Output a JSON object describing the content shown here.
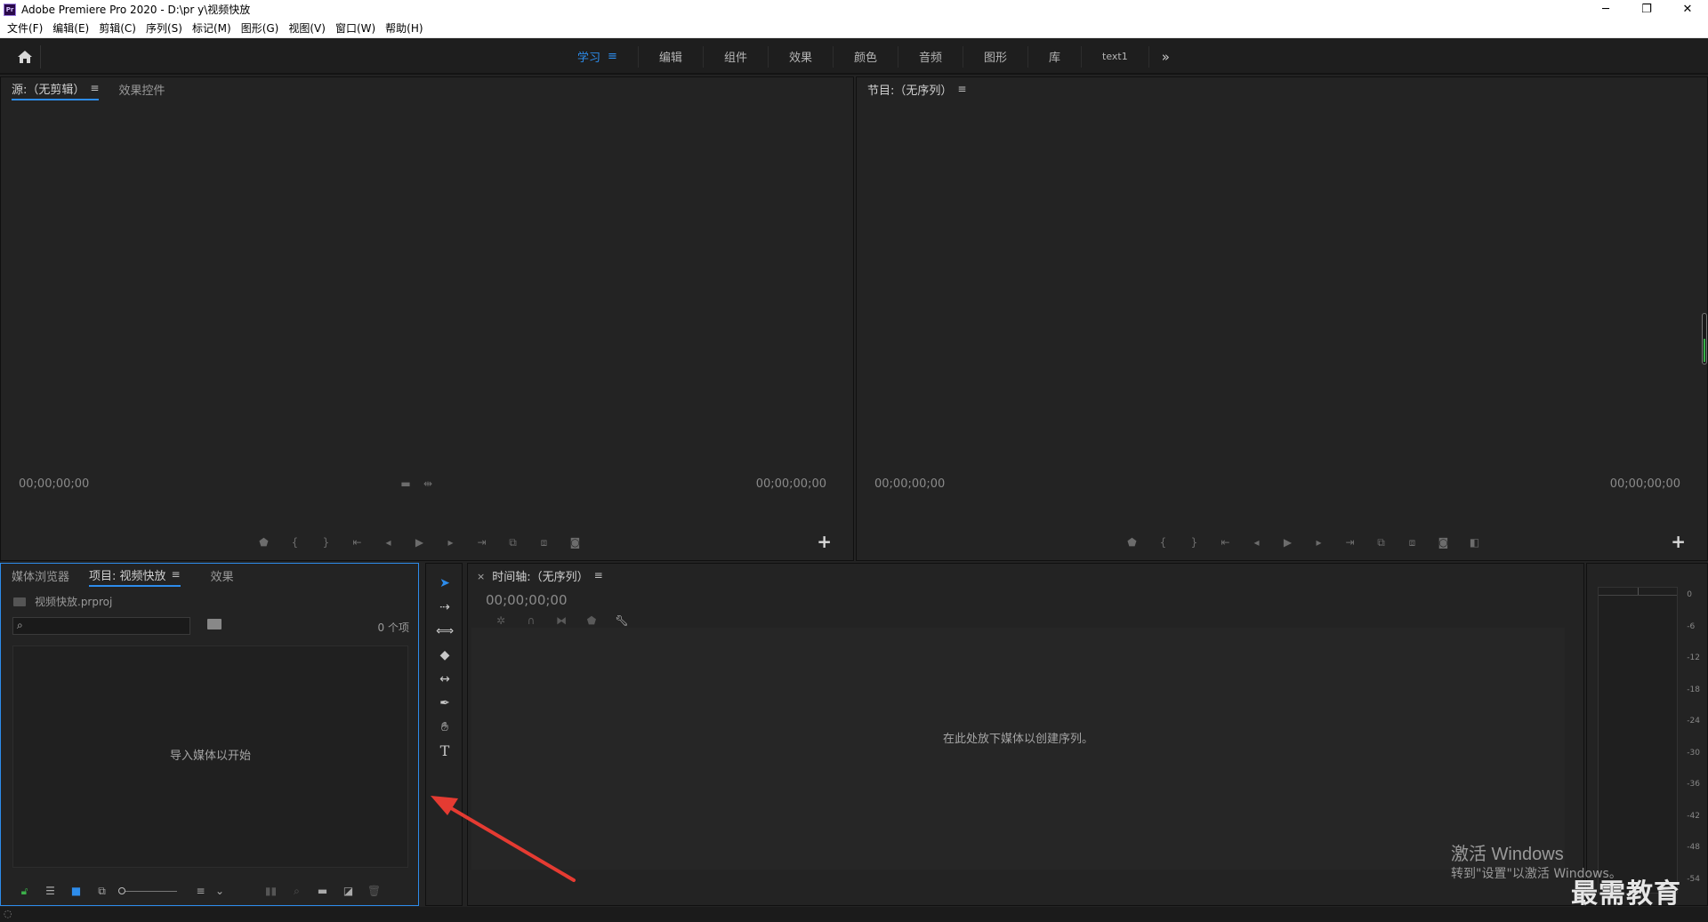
{
  "window": {
    "title": "Adobe Premiere Pro 2020 - D:\\pr y\\视频快放",
    "app_badge": "Pr",
    "minimize": "─",
    "restore": "❐",
    "close": "✕"
  },
  "menubar": {
    "items": [
      "文件(F)",
      "编辑(E)",
      "剪辑(C)",
      "序列(S)",
      "标记(M)",
      "图形(G)",
      "视图(V)",
      "窗口(W)",
      "帮助(H)"
    ]
  },
  "workspaces": {
    "tabs": [
      "学习",
      "编辑",
      "组件",
      "效果",
      "颜色",
      "音频",
      "图形",
      "库",
      "text1"
    ],
    "active": "学习",
    "more": "»"
  },
  "source_panel": {
    "tabs": [
      "源:（无剪辑）",
      "效果控件"
    ],
    "timecode_left": "00;00;00;00",
    "timecode_right": "00;00;00;00"
  },
  "program_panel": {
    "tab": "节目:（无序列）",
    "timecode_left": "00;00;00;00",
    "timecode_right": "00;00;00;00"
  },
  "project_panel": {
    "tabs": [
      "媒体浏览器",
      "项目: 视频快放",
      "效果"
    ],
    "project_file": "视频快放.prproj",
    "item_count": "0 个项",
    "empty_message": "导入媒体以开始"
  },
  "timeline_panel": {
    "tab": "时间轴:（无序列）",
    "timecode": "00;00;00;00",
    "empty_message": "在此处放下媒体以创建序列。"
  },
  "audio_meter": {
    "scale": [
      "0",
      "-6",
      "-12",
      "-18",
      "-24",
      "-30",
      "-36",
      "-42",
      "-48",
      "-54"
    ]
  },
  "watermark": {
    "line1": "激活 Windows",
    "line2": "转到\"设置\"以激活 Windows。",
    "brand": "最需教育"
  },
  "colors": {
    "accent": "#2d8ceb",
    "arrow": "#e53b32"
  }
}
